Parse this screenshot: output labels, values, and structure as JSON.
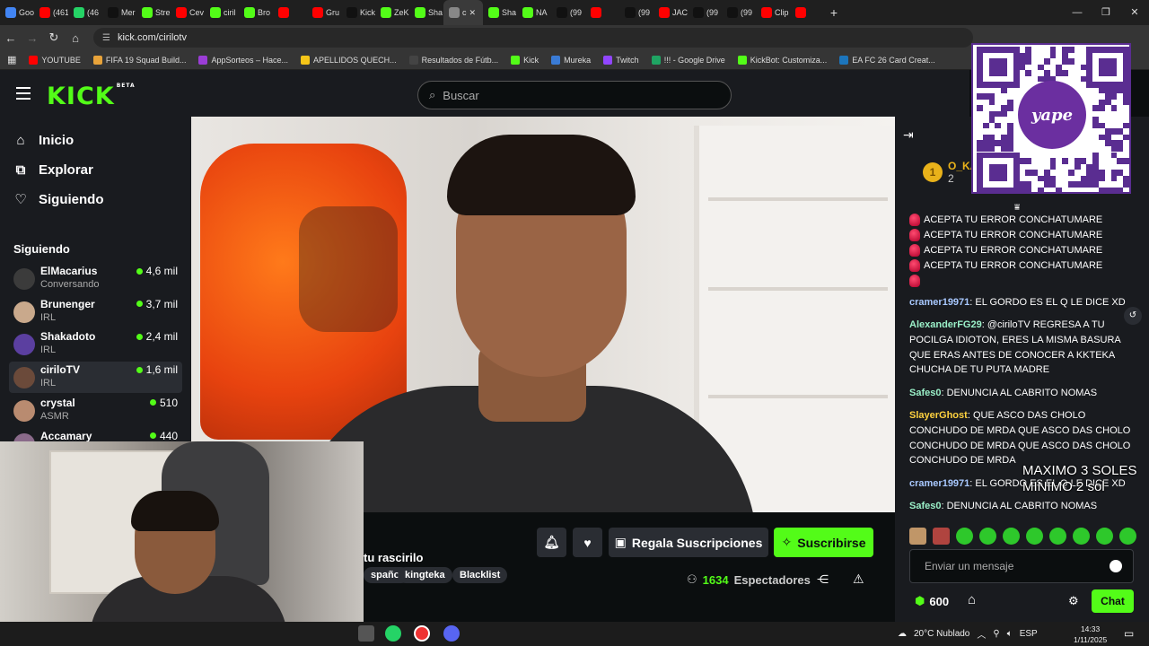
{
  "browser": {
    "tabs": [
      {
        "label": "Goo",
        "color": "#4285f4"
      },
      {
        "label": "(461",
        "color": "#ff0000"
      },
      {
        "label": "(46",
        "color": "#25d366"
      },
      {
        "label": "Mer",
        "color": "#111111"
      },
      {
        "label": "Stre",
        "color": "#53fc18"
      },
      {
        "label": "Cev",
        "color": "#ff0000"
      },
      {
        "label": "ciril",
        "color": "#53fc18"
      },
      {
        "label": "Bro",
        "color": "#53fc18"
      },
      {
        "label": "",
        "color": "#ff0000"
      },
      {
        "label": "Gru",
        "color": "#ff0000"
      },
      {
        "label": "Kick",
        "color": "#111111"
      },
      {
        "label": "ZeK",
        "color": "#53fc18"
      },
      {
        "label": "Sha",
        "color": "#53fc18"
      },
      {
        "label": "c",
        "color": "#888888",
        "active": true
      },
      {
        "label": "Sha",
        "color": "#53fc18"
      },
      {
        "label": "NA",
        "color": "#53fc18"
      },
      {
        "label": "(99",
        "color": "#111111"
      },
      {
        "label": "",
        "color": "#ff0000"
      },
      {
        "label": "(99",
        "color": "#111111"
      },
      {
        "label": "JAC",
        "color": "#ff0000"
      },
      {
        "label": "(99",
        "color": "#111111"
      },
      {
        "label": "(99",
        "color": "#111111"
      },
      {
        "label": "Clip",
        "color": "#ff0000"
      },
      {
        "label": "",
        "color": "#ff0000"
      }
    ],
    "url": "kick.com/cirilotv",
    "bookmarks": [
      {
        "label": "YOUTUBE",
        "color": "#ff0000"
      },
      {
        "label": "FIFA 19 Squad Build...",
        "color": "#e8a33a"
      },
      {
        "label": "AppSorteos – Hace...",
        "color": "#9b3dd6"
      },
      {
        "label": "APELLIDOS QUECH...",
        "color": "#f5c518"
      },
      {
        "label": "Resultados de Fútb...",
        "color": "#444444"
      },
      {
        "label": "Kick",
        "color": "#53fc18"
      },
      {
        "label": "Mureka",
        "color": "#3a7bd5"
      },
      {
        "label": "Twitch",
        "color": "#9146ff"
      },
      {
        "label": "!!! - Google Drive",
        "color": "#1fa463"
      },
      {
        "label": "KickBot: Customiza...",
        "color": "#53fc18"
      },
      {
        "label": "EA FC 26 Card Creat...",
        "color": "#1c75bc"
      }
    ]
  },
  "kick": {
    "logo": "KICK",
    "logo_badge": "BETA",
    "search_placeholder": "Buscar",
    "nav": [
      {
        "label": "Inicio",
        "icon": "home-icon",
        "glyph": "⌂"
      },
      {
        "label": "Explorar",
        "icon": "compass-icon",
        "glyph": "⧉"
      },
      {
        "label": "Siguiendo",
        "icon": "heart-icon",
        "glyph": "♡"
      }
    ],
    "following_title": "Siguiendo",
    "following": [
      {
        "name": "ElMacarius",
        "category": "Conversando",
        "viewers": "4,6 mil",
        "avatar": "#3b3b3b"
      },
      {
        "name": "Brunenger",
        "category": "IRL",
        "viewers": "3,7 mil",
        "avatar": "#c9a98c"
      },
      {
        "name": "Shakadoto",
        "category": "IRL",
        "viewers": "2,4 mil",
        "avatar": "#5b3fa0"
      },
      {
        "name": "ciriloTV",
        "category": "IRL",
        "viewers": "1,6 mil",
        "avatar": "#6b4a3a",
        "active": true
      },
      {
        "name": "crystal",
        "category": "ASMR",
        "viewers": "510",
        "avatar": "#b98b70"
      },
      {
        "name": "Accamary",
        "category": "",
        "viewers": "440",
        "avatar": "#8a6a8a"
      }
    ],
    "stream": {
      "title_fragment": "tu rascirilo",
      "tags": [
        "spañol",
        "kingteka",
        "Blacklist"
      ],
      "viewers_number": "1634",
      "viewers_label": "Espectadores",
      "gift_label": "Regala Suscripciones",
      "subscribe_label": "Suscribirse"
    },
    "chat": {
      "pinned_rank": "1",
      "pinned_user": "O_KA",
      "pinned_count": "2",
      "messages": [
        {
          "user": "",
          "text": "ACEPTA TU ERROR CONCHATUMARE",
          "emote": true
        },
        {
          "user": "",
          "text": "ACEPTA TU ERROR CONCHATUMARE",
          "emote": true
        },
        {
          "user": "",
          "text": "ACEPTA TU ERROR CONCHATUMARE",
          "emote": true
        },
        {
          "user": "",
          "text": "ACEPTA TU ERROR CONCHATUMARE",
          "emote": true
        },
        {
          "user": "",
          "text": "",
          "emote": true
        },
        {
          "user": "cramer19971",
          "text": "EL GORDO ES EL Q LE DICE XD",
          "color": "#a8c8ff"
        },
        {
          "user": "AlexanderFG29",
          "text": "@ciriloTV REGRESA A TU POCILGA IDIOTON, ERES LA MISMA BASURA QUE ERAS ANTES DE CONOCER A KKTEKA CHUCHA DE TU PUTA MADRE",
          "color": "#9af0c8"
        },
        {
          "user": "Safes0",
          "text": "DENUNCIA AL CABRITO NOMAS",
          "color": "#9af0c8"
        },
        {
          "user": "SlayerGhost",
          "text": "QUE ASCO DAS CHOLO CONCHUDO DE MRDA  QUE ASCO DAS CHOLO CONCHUDO DE MRDA  QUE ASCO DAS CHOLO CONCHUDO DE MRDA",
          "color": "#ffd23f"
        },
        {
          "user": "cramer19971",
          "text": "EL GORDO ES EL Q LE DICE XD",
          "color": "#a8c8ff"
        },
        {
          "user": "Safes0",
          "text": "DENUNCIA AL CABRITO NOMAS",
          "color": "#9af0c8"
        }
      ],
      "overlay_line1": "MAXIMO 3 SOLES",
      "overlay_line2": "MINIMO 2 sol",
      "qr_label": "yape",
      "input_placeholder": "Enviar un mensaje",
      "points": "600",
      "send_label": "Chat"
    }
  },
  "taskbar": {
    "weather": "20°C  Nublado",
    "language": "ESP",
    "time": "14:33",
    "date": "1/11/2025"
  },
  "colors": {
    "accent": "#53fc18",
    "bg": "#0b0e0f",
    "panel": "#191b1f"
  }
}
